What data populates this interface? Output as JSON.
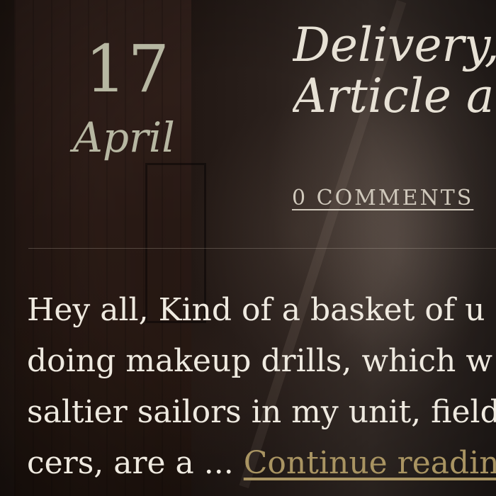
{
  "post": {
    "date": {
      "day": "17",
      "month": "April"
    },
    "title_lines": [
      "Delivery,",
      "Article an"
    ],
    "comments_label": "0 COMMENTS",
    "excerpt_lines": [
      "Hey all, Kind of a basket of u",
      "doing makeup drills, which w",
      "saltier sailors in my unit, field"
    ],
    "excerpt_last_line_text": "cers, are a ... ",
    "continue_label": "Continue reading"
  },
  "colors": {
    "date": "#b7b7a2",
    "title": "#e7e1d5",
    "body_text": "#efeae0",
    "link_accent": "#a99462"
  }
}
